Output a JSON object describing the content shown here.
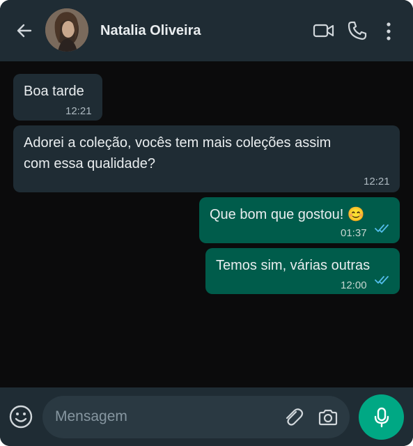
{
  "header": {
    "contact_name": "Natalia Oliveira",
    "icons": [
      "back-arrow-icon",
      "video-call-icon",
      "voice-call-icon",
      "more-options-icon"
    ]
  },
  "messages": [
    {
      "direction": "incoming",
      "text": "Boa tarde",
      "time": "12:21"
    },
    {
      "direction": "incoming",
      "text_lines": [
        "Adorei a coleção, vocês tem mais coleções assim",
        "com essa qualidade?"
      ],
      "time": "12:21"
    },
    {
      "direction": "outgoing",
      "text": "Que bom que gostou! 😊",
      "time": "01:37",
      "status": "read"
    },
    {
      "direction": "outgoing",
      "text": "Temos sim, várias outras",
      "time": "12:00",
      "status": "read"
    }
  ],
  "composer": {
    "placeholder": "Mensagem",
    "icons": [
      "emoji-icon",
      "attach-icon",
      "camera-icon",
      "microphone-icon"
    ]
  },
  "colors": {
    "header_bg": "#1f2c34",
    "chat_bg": "#0b0b0c",
    "incoming_bubble": "#1f2c34",
    "outgoing_bubble": "#005c4b",
    "accent": "#00a884",
    "read_ticks": "#53bdeb"
  }
}
